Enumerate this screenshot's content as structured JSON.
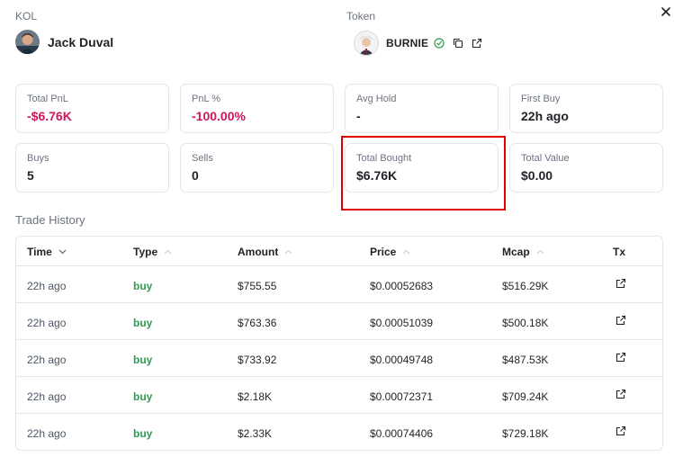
{
  "kol": {
    "label": "KOL",
    "name": "Jack Duval"
  },
  "token": {
    "label": "Token",
    "name": "BURNIE"
  },
  "stats": [
    {
      "label": "Total PnL",
      "value": "-$6.76K",
      "negative": true
    },
    {
      "label": "PnL %",
      "value": "-100.00%",
      "negative": true
    },
    {
      "label": "Avg Hold",
      "value": "-",
      "negative": false
    },
    {
      "label": "First Buy",
      "value": "22h ago",
      "negative": false
    },
    {
      "label": "Buys",
      "value": "5",
      "negative": false
    },
    {
      "label": "Sells",
      "value": "0",
      "negative": false
    },
    {
      "label": "Total Bought",
      "value": "$6.76K",
      "negative": false
    },
    {
      "label": "Total Value",
      "value": "$0.00",
      "negative": false
    }
  ],
  "trade_history": {
    "title": "Trade History",
    "columns": {
      "time": "Time",
      "type": "Type",
      "amount": "Amount",
      "price": "Price",
      "mcap": "Mcap",
      "tx": "Tx"
    },
    "rows": [
      {
        "time": "22h ago",
        "type": "buy",
        "amount": "$755.55",
        "price": "$0.00052683",
        "mcap": "$516.29K"
      },
      {
        "time": "22h ago",
        "type": "buy",
        "amount": "$763.36",
        "price": "$0.00051039",
        "mcap": "$500.18K"
      },
      {
        "time": "22h ago",
        "type": "buy",
        "amount": "$733.92",
        "price": "$0.00049748",
        "mcap": "$487.53K"
      },
      {
        "time": "22h ago",
        "type": "buy",
        "amount": "$2.18K",
        "price": "$0.00072371",
        "mcap": "$709.24K"
      },
      {
        "time": "22h ago",
        "type": "buy",
        "amount": "$2.33K",
        "price": "$0.00074406",
        "mcap": "$729.18K"
      }
    ]
  },
  "colors": {
    "negative": "#d0155e",
    "buy": "#2e9c4f",
    "verified": "#2e9c4f",
    "highlight_border": "#e00000"
  },
  "icons": {
    "close": "close-icon",
    "verified": "verified-check-icon",
    "copy": "copy-icon",
    "external": "external-link-icon",
    "sort_desc": "chevron-down-icon",
    "sort_asc": "chevron-up-icon"
  }
}
